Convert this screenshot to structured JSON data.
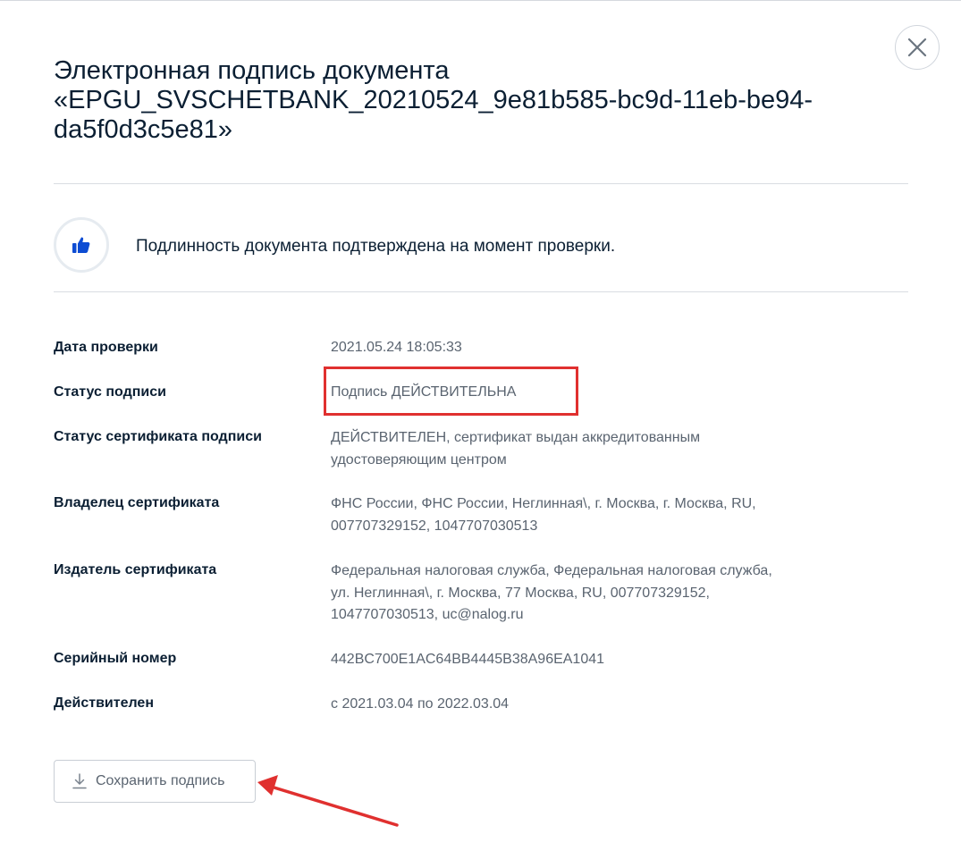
{
  "dialog": {
    "title": "Электронная подпись документа «EPGU_SVSCHETBANK_20210524_9e81b585-bc9d-11eb-be94-da5f0d3c5e81»",
    "close_icon": "close-icon"
  },
  "verification": {
    "icon": "thumbs-up-icon",
    "message": "Подлинность документа подтверждена на момент проверки."
  },
  "details": [
    {
      "label": "Дата проверки",
      "value": "2021.05.24 18:05:33"
    },
    {
      "label": "Статус подписи",
      "value": "Подпись ДЕЙСТВИТЕЛЬНА"
    },
    {
      "label": "Статус сертификата подписи",
      "value": "ДЕЙСТВИТЕЛЕН, сертификат выдан аккредитованным удостоверяющим центром"
    },
    {
      "label": "Владелец сертификата",
      "value": "ФНС России, ФНС России, Неглинная\\, г. Москва, г. Москва, RU, 007707329152, 1047707030513"
    },
    {
      "label": "Издатель сертификата",
      "value": "Федеральная налоговая служба, Федеральная налоговая служба, ул. Неглинная\\, г. Москва, 77 Москва, RU, 007707329152, 1047707030513, uc@nalog.ru"
    },
    {
      "label": "Серийный номер",
      "value": "442BC700E1AC64BB4445B38A96EA1041"
    },
    {
      "label": "Действителен",
      "value": "с 2021.03.04 по 2022.03.04"
    }
  ],
  "actions": {
    "save_label": "Сохранить подпись",
    "save_icon": "download-icon"
  },
  "colors": {
    "accent_blue": "#0d4cd3",
    "annotation_red": "#e0302f"
  }
}
